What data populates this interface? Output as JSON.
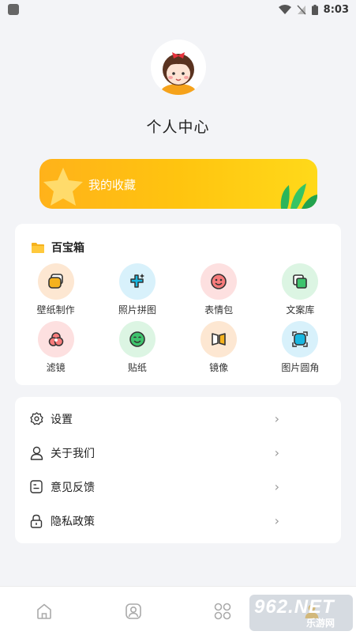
{
  "status_bar": {
    "time": "8:03"
  },
  "profile": {
    "title": "个人中心"
  },
  "favorites": {
    "label": "我的收藏"
  },
  "toolbox": {
    "title": "百宝箱",
    "items": [
      {
        "label": "壁纸制作",
        "icon": "wallpaper-icon",
        "bg": "#fde7d2",
        "fg": "#f0a020"
      },
      {
        "label": "照片拼图",
        "icon": "puzzle-icon",
        "bg": "#d8f1fb",
        "fg": "#19a9d6"
      },
      {
        "label": "表情包",
        "icon": "smiley-icon",
        "bg": "#fde0e0",
        "fg": "#e85a5a"
      },
      {
        "label": "文案库",
        "icon": "copy-library-icon",
        "bg": "#dcf5e3",
        "fg": "#2eaf5c"
      },
      {
        "label": "滤镜",
        "icon": "filter-icon",
        "bg": "#fde0e0",
        "fg": "#e85a5a"
      },
      {
        "label": "贴纸",
        "icon": "sticker-icon",
        "bg": "#dcf5e3",
        "fg": "#2eaf5c"
      },
      {
        "label": "镜像",
        "icon": "mirror-icon",
        "bg": "#fde7d2",
        "fg": "#f0a020"
      },
      {
        "label": "图片圆角",
        "icon": "round-corner-icon",
        "bg": "#d8f1fb",
        "fg": "#19a9d6"
      }
    ]
  },
  "settings": {
    "items": [
      {
        "label": "设置",
        "icon": "gear-icon"
      },
      {
        "label": "关于我们",
        "icon": "user-icon"
      },
      {
        "label": "意见反馈",
        "icon": "feedback-icon"
      },
      {
        "label": "隐私政策",
        "icon": "lock-icon"
      }
    ]
  },
  "bottom_nav": {
    "items": [
      {
        "icon": "home-icon"
      },
      {
        "icon": "portrait-icon"
      },
      {
        "icon": "apps-icon"
      },
      {
        "icon": "profile-icon"
      }
    ]
  },
  "watermark": {
    "main": "962.NET",
    "sub": "乐游网"
  }
}
